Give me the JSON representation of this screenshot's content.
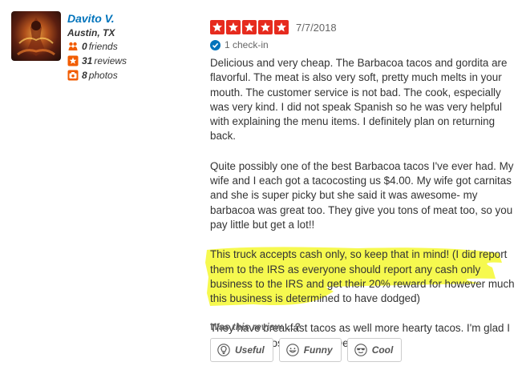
{
  "user": {
    "name": "Davito V.",
    "location": "Austin, TX",
    "friends_count": "0",
    "friends_label": "friends",
    "reviews_count": "31",
    "reviews_label": "reviews",
    "photos_count": "8",
    "photos_label": "photos"
  },
  "review": {
    "rating": 5,
    "date": "7/7/2018",
    "checkin": "1 check-in",
    "paragraphs": [
      "Delicious and very cheap. The Barbacoa tacos and gordita are flavorful. The meat is also very soft, pretty much melts in your mouth. The customer service is not bad. The cook, especially was very kind. I did not speak Spanish so he was very helpful with explaining the menu items. I definitely plan on returning back.",
      "Quite possibly one of the best Barbacoa tacos I've ever had. My wife and I each got a tacocosting us $4.00. My wife got carnitas and she is super picky but she said it was awesome- my barbacoa was great too. They give you tons of meat too, so you pay little but get a lot!!",
      "This truck accepts cash only, so keep that in mind! (I did report them to the IRS as everyone should report any cash only business to the IRS and get their 20% reward for however much this business is determined to have dodged)",
      "They have breakfast tacos as well more hearty tacos. I'm glad I stumbled across this one. Delicious !!"
    ]
  },
  "feedback": {
    "prompt": "Was this review …?",
    "useful": "Useful",
    "funny": "Funny",
    "cool": "Cool"
  },
  "colors": {
    "star_red": "#e62b1e",
    "link_blue": "#0073bb",
    "highlight_yellow": "#f4f830",
    "friends_orange": "#f15c00"
  },
  "icons": {
    "friends": "friends-icon",
    "reviews": "star-icon",
    "photos": "camera-icon",
    "checkin": "checkin-icon",
    "useful": "lightbulb-icon",
    "funny": "smiley-icon",
    "cool": "sunglasses-icon"
  }
}
